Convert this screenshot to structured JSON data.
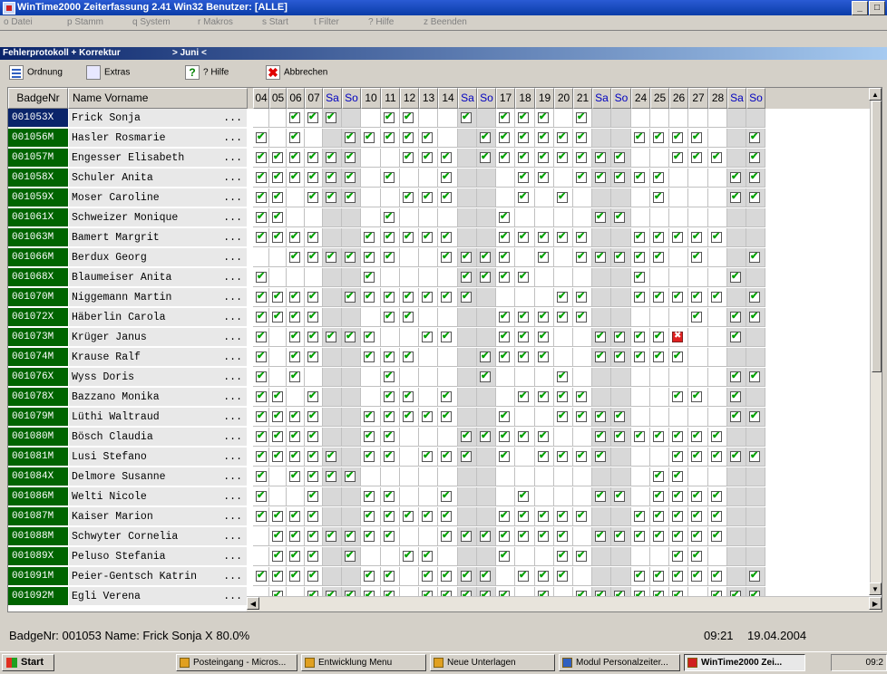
{
  "window": {
    "title": "WinTime2000  Zeiterfassung  2.41 Win32  Benutzer: [ALLE]",
    "buttons": [
      "_",
      "̐",
      "X"
    ]
  },
  "menu": [
    "o Datei",
    "p Stamm",
    "q System",
    "r Makros",
    "s Start",
    "t Filter",
    "? Hilfe",
    "z Beenden"
  ],
  "panel": {
    "title": "Fehlerprotokoll + Korrektur",
    "month": "> Juni <"
  },
  "toolbar": {
    "order": "Ordnung",
    "extras": "Extras",
    "help_icon": "?",
    "help": "? Hilfe",
    "cancel": "Abbrechen"
  },
  "grid": {
    "header_badge": "BadgeNr",
    "header_name": "Name Vorname",
    "dots": "...",
    "days": [
      "04",
      "05",
      "06",
      "07",
      "Sa",
      "So",
      "10",
      "11",
      "12",
      "13",
      "14",
      "Sa",
      "So",
      "17",
      "18",
      "19",
      "20",
      "21",
      "Sa",
      "So",
      "24",
      "25",
      "26",
      "27",
      "28",
      "Sa",
      "So"
    ],
    "rows": [
      {
        "badge": "001053X",
        "name": "Frick Sonja",
        "checks": "0011100110010111010000000000"
      },
      {
        "badge": "001056M",
        "name": "Hasler Rosmarie",
        "checks": "1010011111001111110011110010"
      },
      {
        "badge": "001057M",
        "name": "Engesser Elisabeth",
        "checks": "1111110011101111111100111011"
      },
      {
        "badge": "001058X",
        "name": "Schuler Anita",
        "checks": "1111110100100011011111000111"
      },
      {
        "badge": "001059X",
        "name": "Moser Caroline",
        "checks": "1101110011100010100001000111"
      },
      {
        "badge": "001061X",
        "name": "Schweizer Monique",
        "checks": "1100000100000100001100000000"
      },
      {
        "badge": "001063M",
        "name": "Bamert Margrit",
        "checks": "1111001111100111110011111000"
      },
      {
        "badge": "001066M",
        "name": "Berdux Georg",
        "checks": "0011111100111101011111010011"
      },
      {
        "badge": "001068X",
        "name": "Blaumeiser Anita",
        "checks": "1000001000011110000010000100"
      },
      {
        "badge": "001070M",
        "name": "Niggemann Martin",
        "checks": "1111011111110000110011111011"
      },
      {
        "badge": "001072X",
        "name": "Häberlin Carola",
        "checks": "1111000110000111110000010110"
      },
      {
        "badge": "001073M",
        "name": "Krüger Janus",
        "checks": "1011111001100111001111200100"
      },
      {
        "badge": "001074M",
        "name": "Krause Ralf",
        "checks": "1011001110001111001111100000"
      },
      {
        "badge": "001076X",
        "name": "Wyss Doris",
        "checks": "1010000100001000100000000111"
      },
      {
        "badge": "001078X",
        "name": "Bazzano Monika",
        "checks": "1101000110100011110000110100"
      },
      {
        "badge": "001079M",
        "name": "Lüthi Waltraud",
        "checks": "1111001111100100111100000111"
      },
      {
        "badge": "001080M",
        "name": "Bösch Claudia",
        "checks": "1111001100011111001111111000"
      },
      {
        "badge": "001081M",
        "name": "Lusi Stefano",
        "checks": "1111101101110101111000111110"
      },
      {
        "badge": "001084X",
        "name": "Delmore Susanne",
        "checks": "1011110000000000000001100000"
      },
      {
        "badge": "001086M",
        "name": "Welti Nicole",
        "checks": "1001001100100010001101111000"
      },
      {
        "badge": "001087M",
        "name": "Kaiser Marion",
        "checks": "1111001111100111110011111000"
      },
      {
        "badge": "001088M",
        "name": "Schwyter Cornelia",
        "checks": "0111111100111111101111111000"
      },
      {
        "badge": "001089X",
        "name": "Peluso Stefania",
        "checks": "0111010011000100110000110001"
      },
      {
        "badge": "001091M",
        "name": "Peier-Gentsch Katrin",
        "checks": "1111001101111011100011111011"
      },
      {
        "badge": "001092M",
        "name": "Egli Verena",
        "checks": "0101111101111101011111101111"
      }
    ]
  },
  "status": {
    "left": "BadgeNr: 001053  Name: Frick Sonja  X 80.0%",
    "time": "09:21",
    "date": "19.04.2004"
  },
  "taskbar": {
    "start": "Start",
    "items": [
      "Posteingang - Micros...",
      "Entwicklung Menu",
      "Neue Unterlagen",
      "Modul Personalzeiter...",
      "WinTime2000  Zei..."
    ],
    "clock": "09:2"
  },
  "colors": {
    "badge_bg": "#006400",
    "weekend": "#0000c0",
    "check": "#00a000",
    "error": "#e02020"
  }
}
